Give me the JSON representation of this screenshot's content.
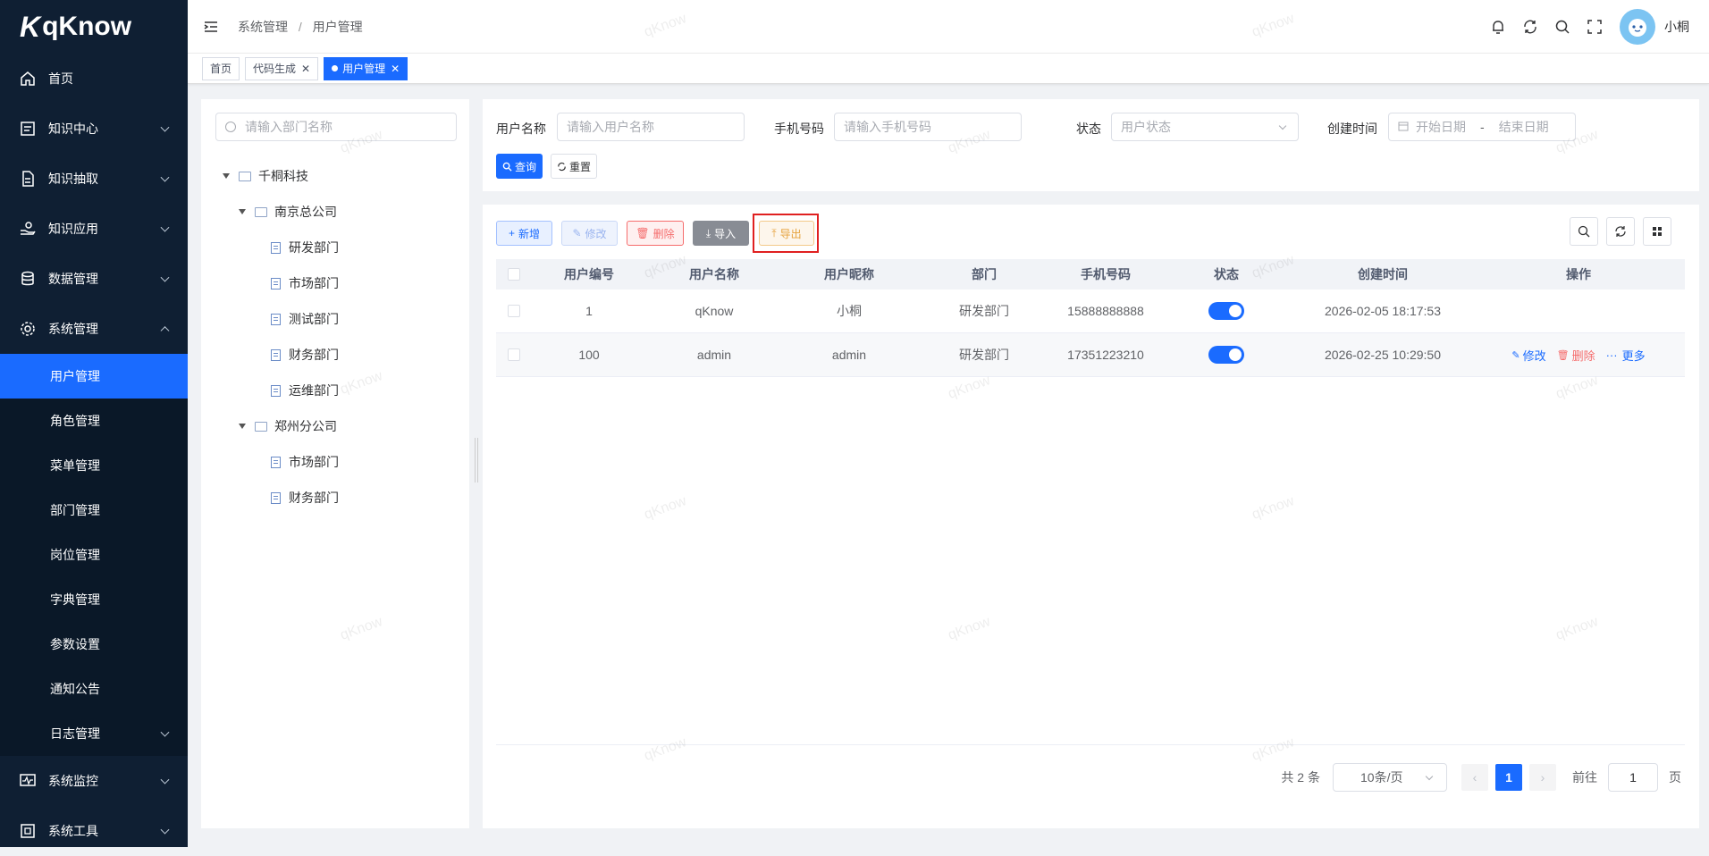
{
  "app": {
    "logo_text": "qKnow",
    "logo_k": "K"
  },
  "sidebar": {
    "items": [
      {
        "label": "首页"
      },
      {
        "label": "知识中心"
      },
      {
        "label": "知识抽取"
      },
      {
        "label": "知识应用"
      },
      {
        "label": "数据管理"
      },
      {
        "label": "系统管理"
      }
    ],
    "sub_items": [
      {
        "label": "用户管理"
      },
      {
        "label": "角色管理"
      },
      {
        "label": "菜单管理"
      },
      {
        "label": "部门管理"
      },
      {
        "label": "岗位管理"
      },
      {
        "label": "字典管理"
      },
      {
        "label": "参数设置"
      },
      {
        "label": "通知公告"
      },
      {
        "label": "日志管理"
      }
    ],
    "bottom_items": [
      {
        "label": "系统监控"
      },
      {
        "label": "系统工具"
      }
    ]
  },
  "header": {
    "breadcrumb": [
      "系统管理",
      "用户管理"
    ],
    "breadcrumb_sep": "/",
    "username": "小桐"
  },
  "tags": [
    {
      "label": "首页"
    },
    {
      "label": "代码生成"
    },
    {
      "label": "用户管理"
    }
  ],
  "tree": {
    "search_placeholder": "请输入部门名称",
    "root": "千桐科技",
    "groups": [
      {
        "label": "南京总公司",
        "children": [
          "研发部门",
          "市场部门",
          "测试部门",
          "财务部门",
          "运维部门"
        ]
      },
      {
        "label": "郑州分公司",
        "children": [
          "市场部门",
          "财务部门"
        ]
      }
    ]
  },
  "filters": {
    "username_label": "用户名称",
    "username_placeholder": "请输入用户名称",
    "phone_label": "手机号码",
    "phone_placeholder": "请输入手机号码",
    "status_label": "状态",
    "status_placeholder": "用户状态",
    "date_label": "创建时间",
    "date_start": "开始日期",
    "date_sep": "-",
    "date_end": "结束日期",
    "search_btn": "查询",
    "reset_btn": "重置"
  },
  "toolbar": {
    "add": "新增",
    "edit": "修改",
    "delete": "删除",
    "import": "导入",
    "export": "导出"
  },
  "table": {
    "headers": [
      "用户编号",
      "用户名称",
      "用户昵称",
      "部门",
      "手机号码",
      "状态",
      "创建时间",
      "操作"
    ],
    "rows": [
      {
        "id": "1",
        "name": "qKnow",
        "nick": "小桐",
        "dept": "研发部门",
        "phone": "15888888888",
        "status": true,
        "created": "2026-02-05 18:17:53",
        "ops": []
      },
      {
        "id": "100",
        "name": "admin",
        "nick": "admin",
        "dept": "研发部门",
        "phone": "17351223210",
        "status": true,
        "created": "2026-02-25 10:29:50",
        "ops": [
          "修改",
          "删除",
          "更多"
        ]
      }
    ]
  },
  "pagination": {
    "total": "共 2 条",
    "page_size": "10条/页",
    "current": "1",
    "goto_label": "前往",
    "goto_value": "1",
    "page_suffix": "页"
  },
  "watermark": "qKnow",
  "colors": {
    "primary": "#1a6bff",
    "sidebar_bg": "#0f1f33",
    "danger": "#f56c6c",
    "warning": "#e6a23c"
  }
}
